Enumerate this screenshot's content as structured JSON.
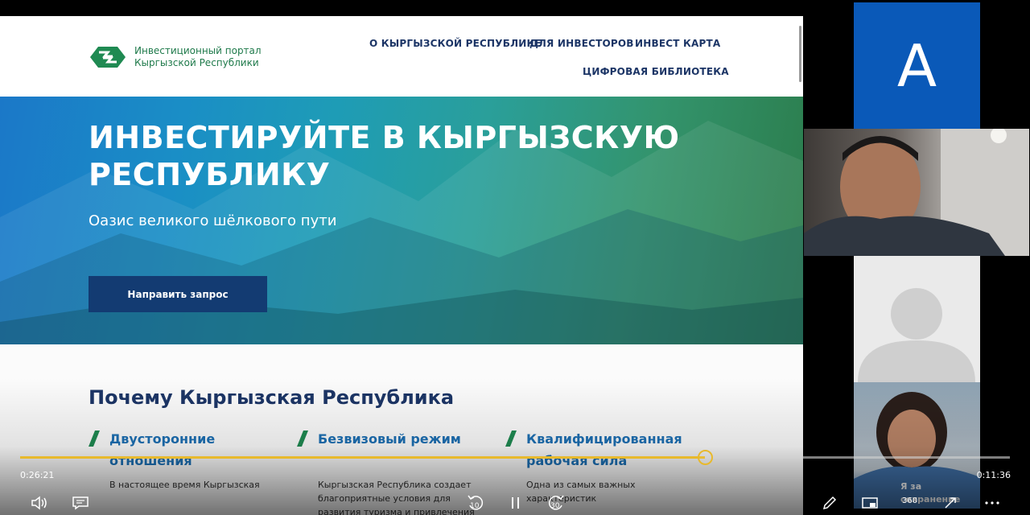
{
  "site": {
    "logo_line1": "Инвестиционный портал",
    "logo_line2": "Кыргызской Республики",
    "nav": [
      {
        "label": "О КЫРГЫЗСКОЙ РЕСПУБЛИКЕ"
      },
      {
        "label": "ДЛЯ ИНВЕСТОРОВ"
      },
      {
        "label": "ИНВЕСТ КАРТА"
      },
      {
        "label": "ЦИФРОВАЯ БИБЛИОТЕКА"
      }
    ],
    "hero": {
      "title": "ИНВЕСТИРУЙТЕ В КЫРГЫЗСКУЮ РЕСПУБЛИКУ",
      "subtitle": "Оазис великого шёлкового пути",
      "button": "Направить запрос"
    },
    "why": {
      "title": "Почему Кыргызская Республика",
      "features": [
        {
          "title": "Двусторонние отношения",
          "text": "В настоящее время Кыргызская"
        },
        {
          "title": "Безвизовый режим",
          "text": "Кыргызская Республика создает благоприятные условия для развития туризма и привлечения бизнес-"
        },
        {
          "title": "Квалифицированная рабочая сила",
          "text": "Одна из самых важных характеристик"
        }
      ]
    },
    "colors": {
      "brand_green": "#1f7a4b",
      "navy": "#1c3566",
      "accent_blue": "#1c6fb3",
      "button_navy": "#133b72"
    }
  },
  "player": {
    "elapsed": "0:26:21",
    "remaining": "0:11:36",
    "progress": 0.692,
    "rewind_label": "10",
    "forward_label": "30",
    "view_label": "360",
    "accent": "#e8b92c",
    "icons": [
      "volume-icon",
      "captions-icon",
      "rewind-10-icon",
      "pause-icon",
      "forward-30-icon",
      "pen-icon",
      "picture-in-picture-icon",
      "360-view-icon",
      "expand-icon",
      "more-icon"
    ]
  },
  "participants": {
    "avatar_letter": "А",
    "avatar_color": "#0a59b8",
    "banner": "Я за сохранение ЕДИНЦОВ!"
  }
}
